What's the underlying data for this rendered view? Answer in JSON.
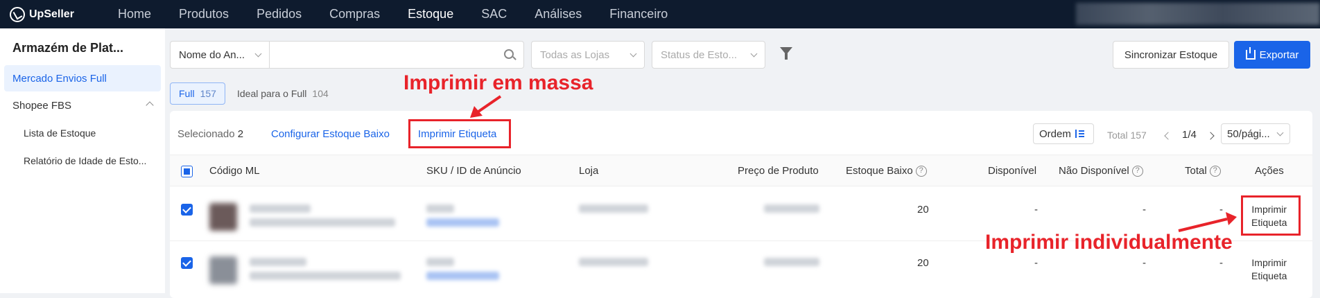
{
  "brand": "UpSeller",
  "nav": [
    "Home",
    "Produtos",
    "Pedidos",
    "Compras",
    "Estoque",
    "SAC",
    "Análises",
    "Financeiro"
  ],
  "nav_active": "Estoque",
  "sidebar": {
    "title": "Armazém de Plat...",
    "items": [
      {
        "label": "Mercado Envios Full",
        "active": true
      },
      {
        "label": "Shopee FBS",
        "expanded": true
      },
      {
        "label": "Lista de Estoque"
      },
      {
        "label": "Relatório de Idade de Esto..."
      }
    ]
  },
  "filters": {
    "field_select": "Nome do An...",
    "search_placeholder": "",
    "store_placeholder": "Todas as Lojas",
    "status_placeholder": "Status de Esto..."
  },
  "buttons": {
    "sync": "Sincronizar Estoque",
    "export": "Exportar"
  },
  "tabs": [
    {
      "label": "Full",
      "count": "157",
      "active": true
    },
    {
      "label": "Ideal para o Full",
      "count": "104"
    }
  ],
  "toolbar": {
    "selected_label": "Selecionado",
    "selected_count": "2",
    "config_low_stock": "Configurar Estoque Baixo",
    "print_label": "Imprimir Etiqueta",
    "order": "Ordem",
    "total": "Total 157",
    "page": "1/4",
    "page_size": "50/pági..."
  },
  "table": {
    "columns": [
      "Código ML",
      "SKU / ID de Anúncio",
      "Loja",
      "Preço de Produto",
      "Estoque Baixo",
      "Disponível",
      "Não Disponível",
      "Total",
      "Ações"
    ],
    "rows": [
      {
        "estoque_baixo": "20",
        "disponivel": "-",
        "nao_disponivel": "-",
        "total": "-",
        "acao": "Imprimir Etiqueta",
        "acao_l1": "Imprimir",
        "acao_l2": "Etiqueta"
      },
      {
        "estoque_baixo": "20",
        "disponivel": "-",
        "nao_disponivel": "-",
        "total": "-",
        "acao": "Imprimir Etiqueta",
        "acao_l1": "Imprimir",
        "acao_l2": "Etiqueta"
      }
    ]
  },
  "annotations": {
    "bulk": "Imprimir em massa",
    "single": "Imprimir individualmente"
  },
  "colors": {
    "accent": "#1a64e8",
    "topbar": "#0e1b2e",
    "annotation": "#e8232a"
  }
}
